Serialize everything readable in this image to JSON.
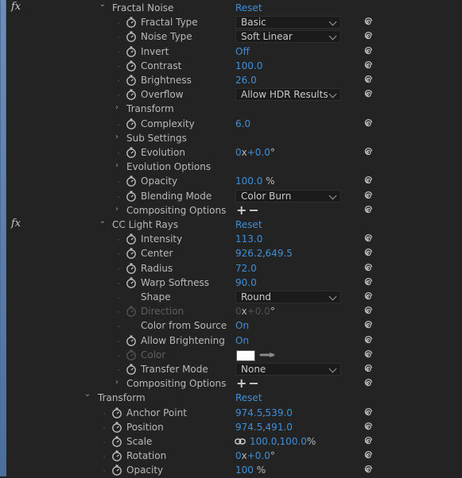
{
  "reset_label": "Reset",
  "fx_label": "fx",
  "colors": {
    "value_blue": "#3f8fd8",
    "panel_bg": "#232323",
    "label": "#b9b9b9"
  },
  "rows": [
    {
      "id": "fractal-noise",
      "kind": "effect",
      "name": "Fractal Noise",
      "value": "Reset"
    },
    {
      "id": "fractal-type",
      "kind": "prop",
      "stopwatch": true,
      "name": "Fractal Type",
      "dropdown": "Basic"
    },
    {
      "id": "noise-type",
      "kind": "prop",
      "stopwatch": true,
      "name": "Noise Type",
      "dropdown": "Soft Linear"
    },
    {
      "id": "invert",
      "kind": "prop",
      "stopwatch": true,
      "name": "Invert",
      "value": "Off"
    },
    {
      "id": "contrast",
      "kind": "prop",
      "stopwatch": true,
      "name": "Contrast",
      "value": "100.0"
    },
    {
      "id": "brightness",
      "kind": "prop",
      "stopwatch": true,
      "name": "Brightness",
      "value": "26.0"
    },
    {
      "id": "overflow",
      "kind": "prop",
      "stopwatch": true,
      "name": "Overflow",
      "dropdown": "Allow HDR Results"
    },
    {
      "id": "transform-group",
      "kind": "group",
      "name": "Transform"
    },
    {
      "id": "complexity",
      "kind": "prop",
      "stopwatch": true,
      "name": "Complexity",
      "value": "6.0"
    },
    {
      "id": "sub-settings",
      "kind": "group",
      "name": "Sub Settings"
    },
    {
      "id": "evolution",
      "kind": "prop",
      "stopwatch": true,
      "name": "Evolution",
      "value": "0",
      "unit": "x",
      "value2": "+0.0",
      "unit2": "°"
    },
    {
      "id": "evolution-options",
      "kind": "group",
      "name": "Evolution Options"
    },
    {
      "id": "opacity",
      "kind": "prop",
      "stopwatch": true,
      "name": "Opacity",
      "value": "100.0",
      "unit": " %"
    },
    {
      "id": "blending-mode",
      "kind": "prop",
      "stopwatch": true,
      "name": "Blending Mode",
      "dropdown": "Color Burn"
    },
    {
      "id": "compositing-options-1",
      "kind": "group",
      "name": "Compositing Options",
      "plusminus": "+−"
    },
    {
      "id": "cc-light-rays",
      "kind": "effect",
      "name": "CC Light Rays",
      "value": "Reset"
    },
    {
      "id": "intensity",
      "kind": "prop",
      "stopwatch": true,
      "name": "Intensity",
      "value": "113.0"
    },
    {
      "id": "center",
      "kind": "prop",
      "stopwatch": true,
      "name": "Center",
      "value": "926.2",
      "sep": ",",
      "value2": "649.5"
    },
    {
      "id": "radius",
      "kind": "prop",
      "stopwatch": true,
      "name": "Radius",
      "value": "72.0"
    },
    {
      "id": "warp-softness",
      "kind": "prop",
      "stopwatch": true,
      "name": "Warp Softness",
      "value": "90.0"
    },
    {
      "id": "shape",
      "kind": "prop",
      "stopwatch": false,
      "name": "Shape",
      "dropdown": "Round"
    },
    {
      "id": "direction",
      "kind": "prop",
      "stopwatch": true,
      "dim": true,
      "name": "Direction",
      "value": "0",
      "unit": "x",
      "value2": "+0.0",
      "unit2": "°"
    },
    {
      "id": "color-from-source",
      "kind": "prop",
      "stopwatch": false,
      "name": "Color from Source",
      "value": "On"
    },
    {
      "id": "allow-brightening",
      "kind": "prop",
      "stopwatch": true,
      "name": "Allow Brightening",
      "value": "On"
    },
    {
      "id": "color",
      "kind": "prop",
      "stopwatch": true,
      "dim": true,
      "name": "Color",
      "swatch": "#ffffff"
    },
    {
      "id": "transfer-mode",
      "kind": "prop",
      "stopwatch": true,
      "name": "Transfer Mode",
      "dropdown": "None"
    },
    {
      "id": "compositing-options-2",
      "kind": "group",
      "name": "Compositing Options",
      "plusminus": "+−"
    },
    {
      "id": "transform",
      "kind": "transform",
      "name": "Transform",
      "value": "Reset"
    },
    {
      "id": "anchor-point",
      "kind": "tprop",
      "stopwatch": true,
      "name": "Anchor Point",
      "value": "974.5",
      "sep": ",",
      "value2": "539.0"
    },
    {
      "id": "position",
      "kind": "tprop",
      "stopwatch": true,
      "name": "Position",
      "value": "974.5",
      "sep": ",",
      "value2": "491.0"
    },
    {
      "id": "scale",
      "kind": "tprop",
      "stopwatch": true,
      "name": "Scale",
      "link": true,
      "value": "100.0",
      "sep": ",",
      "value2": "100.0",
      "unit2": "%"
    },
    {
      "id": "rotation",
      "kind": "tprop",
      "stopwatch": true,
      "name": "Rotation",
      "value": "0",
      "unit": "x",
      "value2": "+0.0",
      "unit2": "°"
    },
    {
      "id": "t-opacity",
      "kind": "tprop",
      "stopwatch": true,
      "name": "Opacity",
      "value": "100",
      "unit": " %"
    }
  ]
}
